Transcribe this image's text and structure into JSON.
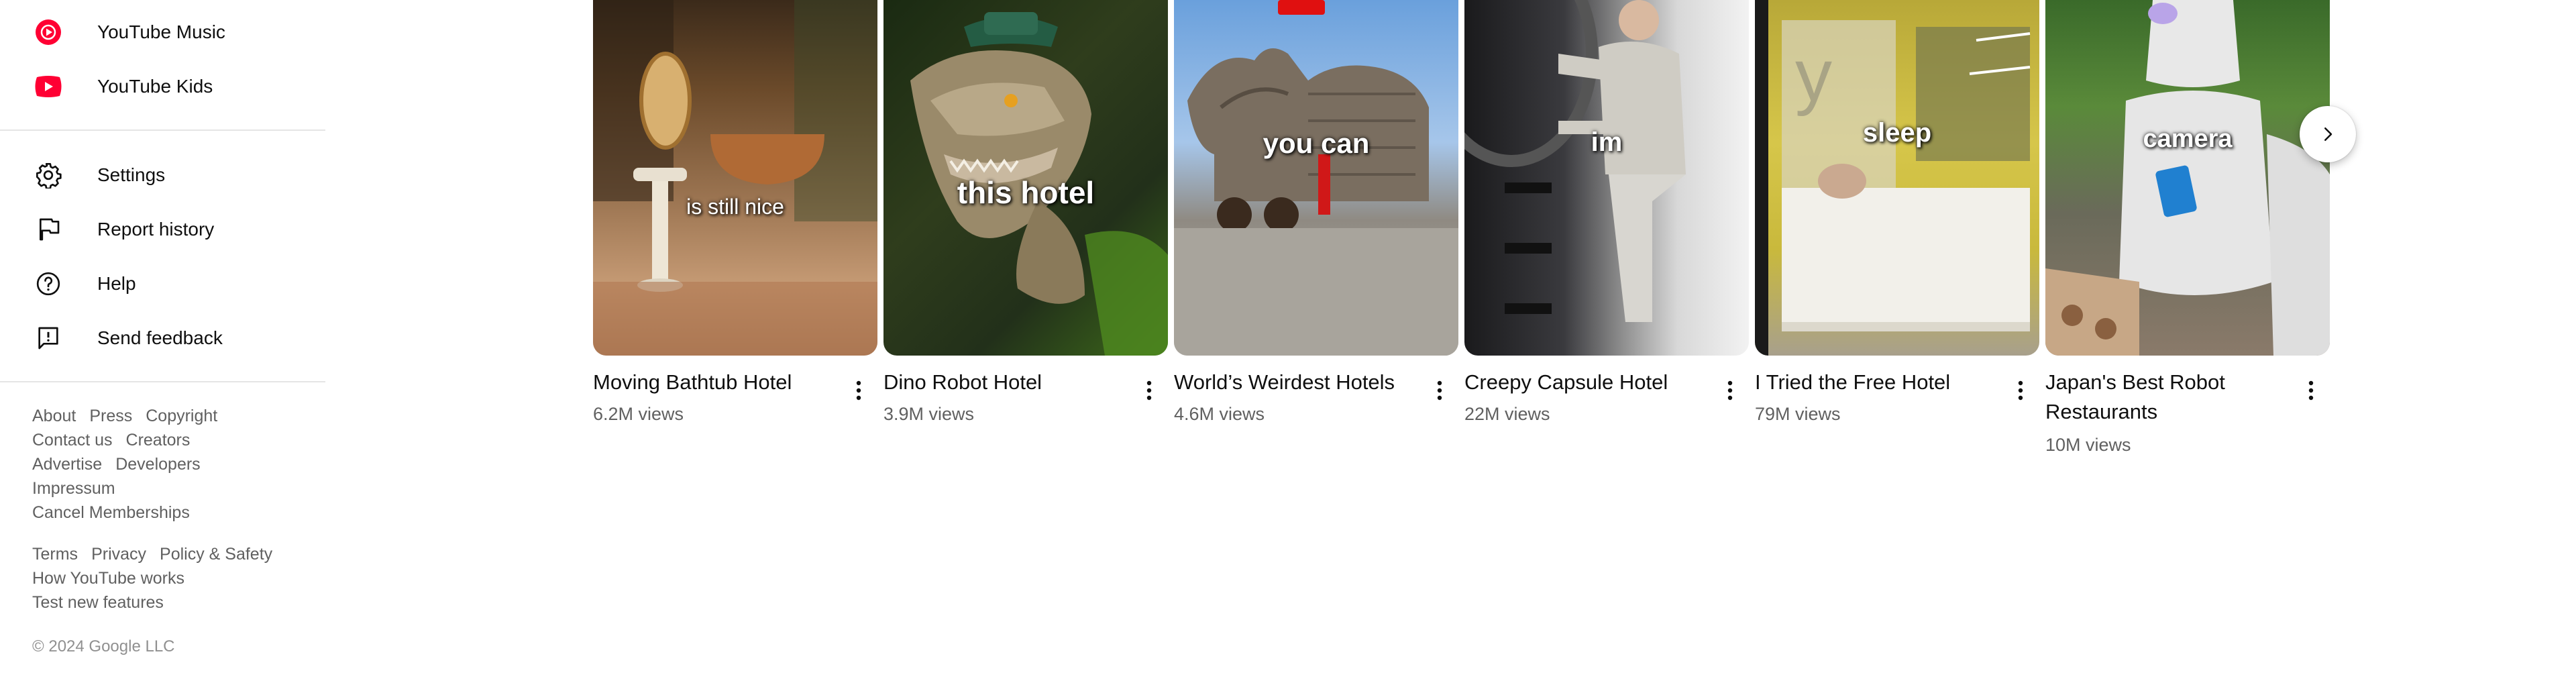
{
  "sidebar": {
    "explore_items": [
      {
        "label": "YouTube Music",
        "icon": "youtube-music-icon"
      },
      {
        "label": "YouTube Kids",
        "icon": "youtube-kids-icon"
      }
    ],
    "settings_items": [
      {
        "label": "Settings",
        "icon": "gear-icon"
      },
      {
        "label": "Report history",
        "icon": "flag-icon"
      },
      {
        "label": "Help",
        "icon": "help-icon"
      },
      {
        "label": "Send feedback",
        "icon": "feedback-icon"
      }
    ],
    "footer_links_1": [
      "About",
      "Press",
      "Copyright",
      "Contact us",
      "Creators",
      "Advertise",
      "Developers",
      "Impressum",
      "Cancel Memberships"
    ],
    "footer_links_2": [
      "Terms",
      "Privacy",
      "Policy & Safety",
      "How YouTube works",
      "Test new features"
    ],
    "copyright": "© 2024 Google LLC"
  },
  "shelf": {
    "videos": [
      {
        "title": "Moving Bathtub Hotel",
        "views": "6.2M views",
        "overlay": "is still nice"
      },
      {
        "title": "Dino Robot Hotel",
        "views": "3.9M views",
        "overlay": "this hotel"
      },
      {
        "title": "World’s Weirdest Hotels",
        "views": "4.6M views",
        "overlay": "you can"
      },
      {
        "title": "Creepy Capsule Hotel",
        "views": "22M views",
        "overlay": "im"
      },
      {
        "title": "I Tried the Free Hotel",
        "views": "79M views",
        "overlay": "sleep"
      },
      {
        "title": "Japan's Best Robot Restaurants",
        "views": "10M views",
        "overlay": "camera"
      }
    ]
  },
  "colors": {
    "youtube_red": "#ff0033",
    "text_primary": "#0f0f0f",
    "text_secondary": "#606060",
    "divider": "#e5e5e5"
  }
}
